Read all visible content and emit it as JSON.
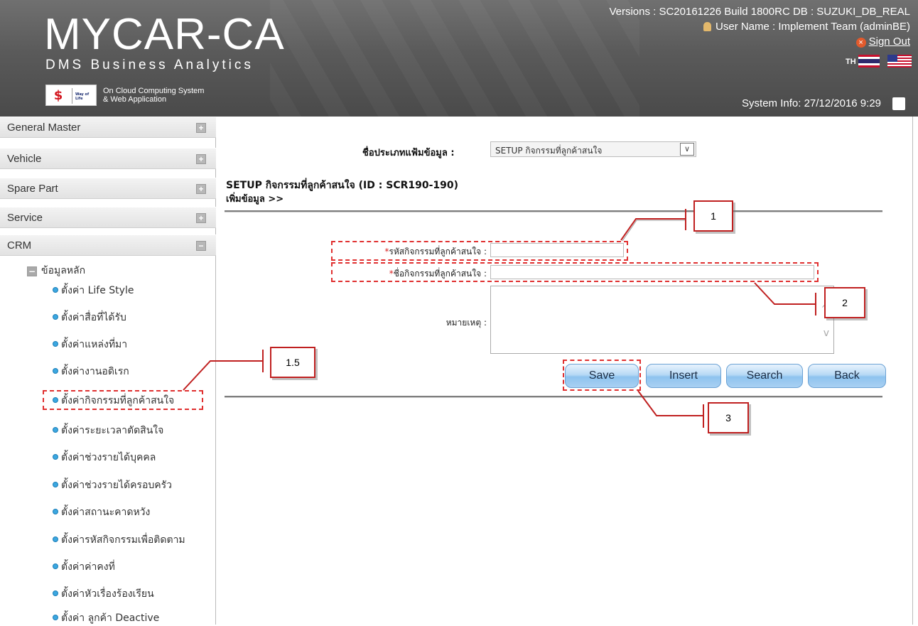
{
  "header": {
    "title": "MYCAR-CA",
    "subtitle": "DMS Business Analytics",
    "cloud_text_1": "On Cloud Computing System",
    "cloud_text_2": "& Web Application",
    "logo_text": "Way of Life",
    "versions": "Versions : SC20161226 Build 1800RC DB : SUZUKI_DB_REAL",
    "user": "User Name : Implement Team (adminBE)",
    "sign_out": "Sign Out",
    "lang_th": "TH",
    "system_info": "System Info: 27/12/2016 9:29"
  },
  "sidebar": {
    "menus": [
      {
        "label": "General Master",
        "icon": "plus-icon",
        "toggle": "+"
      },
      {
        "label": "Vehicle",
        "icon": "plus-icon",
        "toggle": "+"
      },
      {
        "label": "Spare Part",
        "icon": "plus-icon",
        "toggle": "+"
      },
      {
        "label": "Service",
        "icon": "plus-icon",
        "toggle": "+"
      },
      {
        "label": "CRM",
        "icon": "minus-icon",
        "toggle": "−"
      }
    ],
    "tree_root": {
      "label": "ข้อมูลหลัก",
      "toggle": "−"
    },
    "items": [
      "ตั้งค่า Life Style",
      "ตั้งค่าสื่อที่ได้รับ",
      "ตั้งค่าแหล่งที่มา",
      "ตั้งค่างานอดิเรก",
      "ตั้งค่ากิจกรรมที่ลูกค้าสนใจ",
      "ตั้งค่าระยะเวลาตัดสินใจ",
      "ตั้งค่าช่วงรายได้บุคคล",
      "ตั้งค่าช่วงรายได้ครอบครัว",
      "ตั้งค่าสถานะคาดหวัง",
      "ตั้งค่ารหัสกิจกรรมเพื่อติดตาม",
      "ตั้งค่าค่าคงที่",
      "ตั้งค่าหัวเรื่องร้องเรียน",
      "ตั้งค่า ลูกค้า Deactive"
    ]
  },
  "main": {
    "filetype_label": "ชื่อประเภทแฟ้มข้อมูล :",
    "filetype_value": "SETUP กิจกรรมที่ลูกค้าสนใจ",
    "heading": "SETUP กิจกรรมที่ลูกค้าสนใจ (ID : SCR190-190)",
    "sub_heading": "เพิ่มข้อมูล >>",
    "form": {
      "code_label": "รหัสกิจกรรมที่ลูกค้าสนใจ :",
      "code_value": "",
      "name_label": "ชื่อกิจกรรมที่ลูกค้าสนใจ :",
      "name_value": "",
      "remark_label": "หมายเหตุ :",
      "remark_value": "",
      "required_mark": "*"
    },
    "buttons": {
      "save": "Save",
      "insert": "Insert",
      "search": "Search",
      "back": "Back"
    }
  },
  "annotations": {
    "callout_1": "1",
    "callout_2": "2",
    "callout_3": "3",
    "callout_15": "1.5",
    "color": "#e03030"
  },
  "colors": {
    "header_bg": "#5a5a5a",
    "bullet": "#3ca7e0",
    "button_border": "#6aa1d4"
  }
}
